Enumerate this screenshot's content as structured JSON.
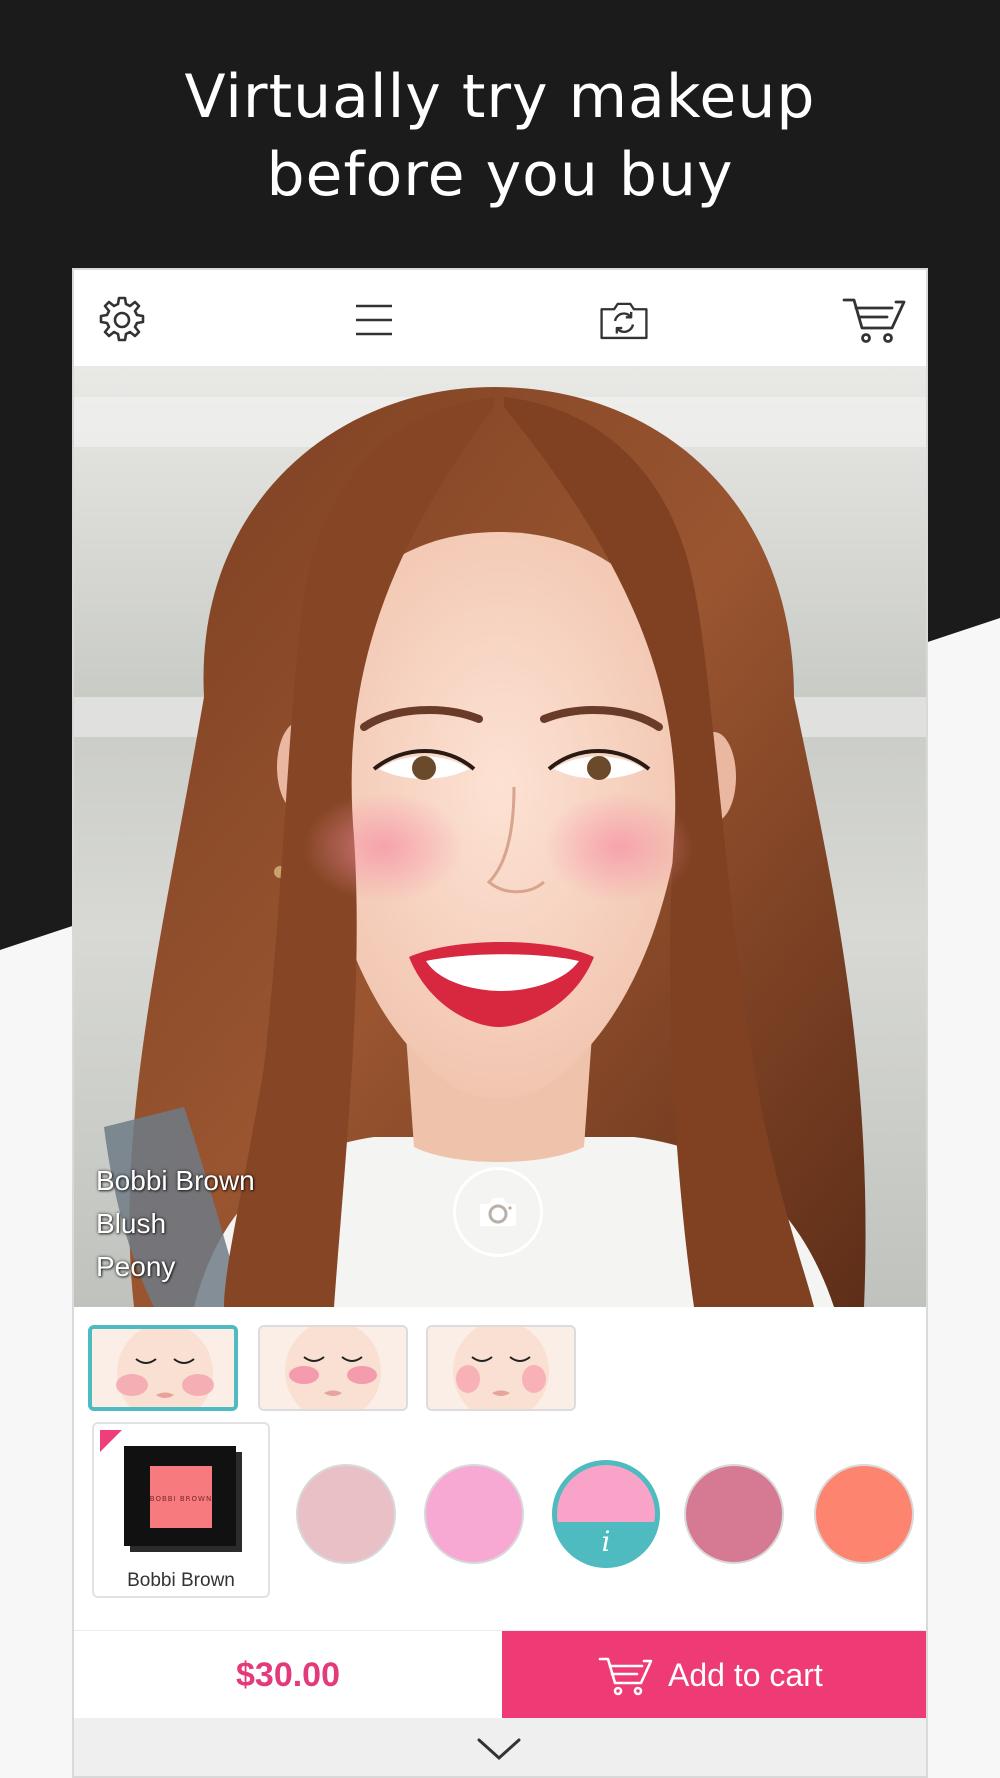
{
  "promo": {
    "headline_line1": "Virtually try makeup",
    "headline_line2": "before you buy"
  },
  "toolbar": {
    "icons": [
      "gear-icon",
      "hamburger-menu-icon",
      "camera-switch-icon",
      "cart-icon"
    ]
  },
  "preview": {
    "brand": "Bobbi Brown",
    "category": "Blush",
    "shade": "Peony",
    "capture_icon": "camera-icon"
  },
  "looks": {
    "selected_index": 0,
    "count": 3
  },
  "product": {
    "brand_label": "Bobbi Brown",
    "compact_text": "BOBBI BROWN"
  },
  "shades": {
    "selected_index": 2,
    "info_glyph": "i",
    "colors": [
      "#e8c0c5",
      "#f8a9d3",
      "#f9a3c8",
      "#d67a93",
      "#fd8570"
    ]
  },
  "purchase": {
    "price": "$30.00",
    "add_to_cart_label": "Add to cart"
  },
  "colors": {
    "accent_pink": "#ee3a75",
    "teal": "#4dbbbf",
    "dark_bg": "#1b1b1b"
  }
}
